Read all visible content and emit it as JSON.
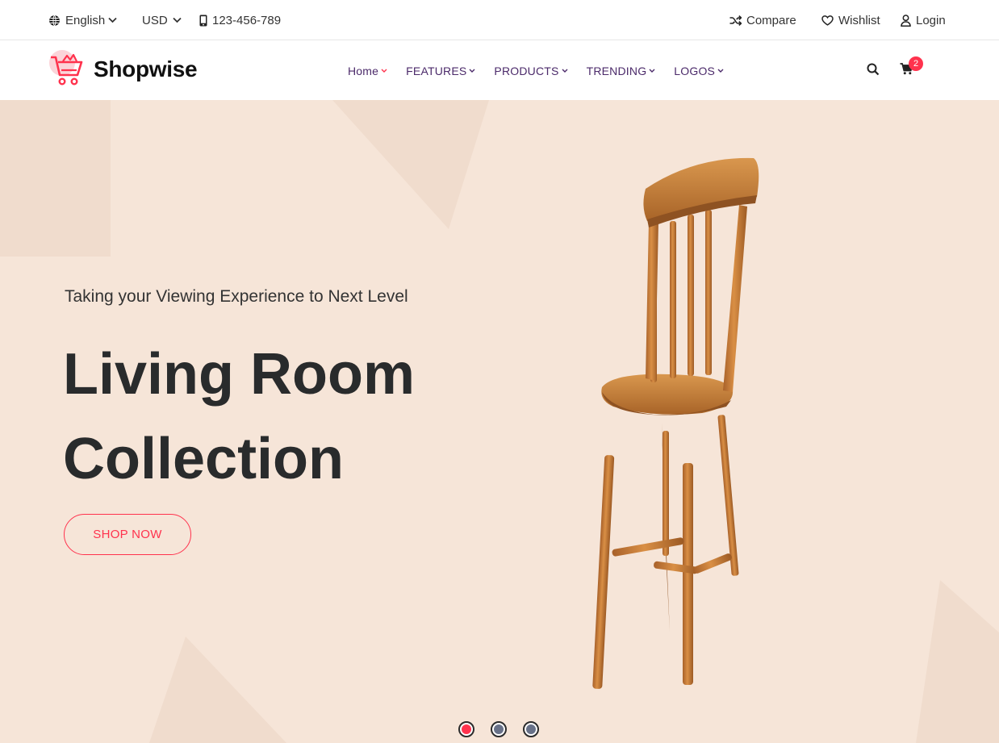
{
  "topbar": {
    "language": "English",
    "currency": "USD",
    "phone": "123-456-789",
    "compare": "Compare",
    "wishlist": "Wishlist",
    "login": "Login"
  },
  "header": {
    "brand": "Shopwise",
    "nav": [
      {
        "label": "Home",
        "active": true
      },
      {
        "label": "FEATURES"
      },
      {
        "label": "PRODUCTS"
      },
      {
        "label": "TRENDING"
      },
      {
        "label": "LOGOS"
      }
    ],
    "cart_count": "2"
  },
  "hero": {
    "subtitle": "Taking your Viewing Experience to Next Level",
    "title_line1": "Living Room",
    "title_line2": "Collection",
    "cta": "SHOP NOW",
    "slides": 3,
    "active_slide": 1
  },
  "colors": {
    "accent": "#ff324d",
    "nav_text": "#4b2a6a",
    "hero_bg": "#f6e5d8",
    "dot_inactive": "#687188"
  }
}
